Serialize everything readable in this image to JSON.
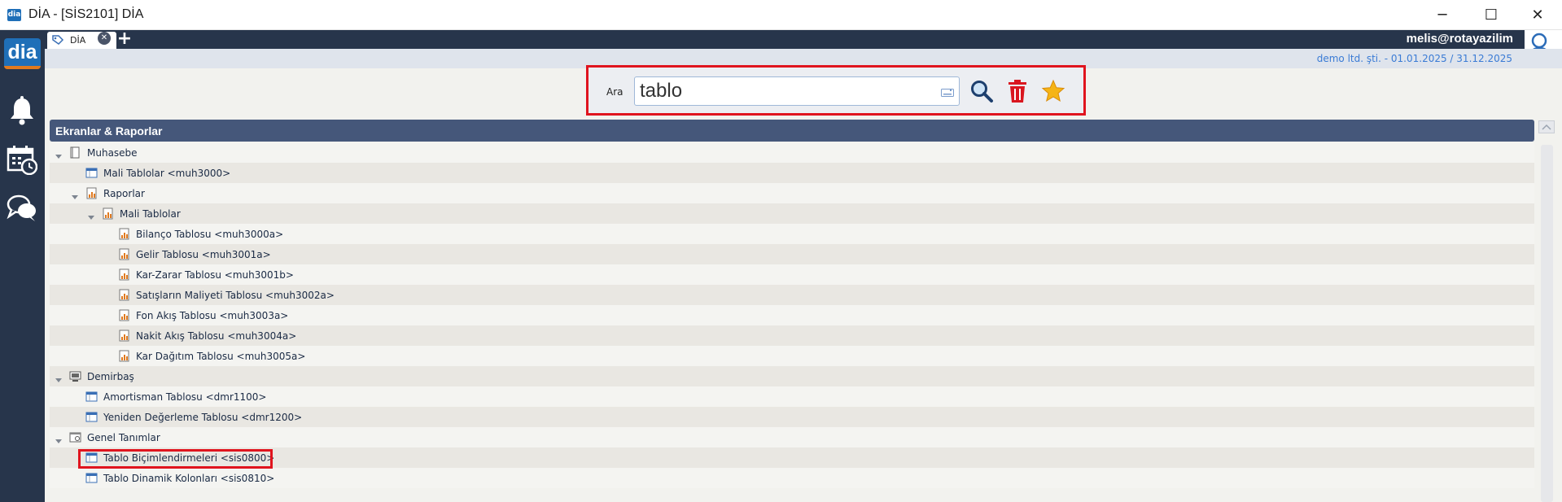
{
  "window": {
    "title": "DİA - [SİS2101] DİA",
    "minimize": "─",
    "maximize": "☐",
    "close": "✕"
  },
  "sidebar": {
    "logo": "dia",
    "icons": [
      "bell-icon",
      "calendar-clock-icon",
      "chat-icon"
    ]
  },
  "tabs": [
    {
      "label": "DİA",
      "close": "✕"
    }
  ],
  "tab_add": "+",
  "user": {
    "email": "melis@rotayazilim",
    "period": "demo ltd. şti. - 01.01.2025 / 31.12.2025"
  },
  "search": {
    "label": "Ara",
    "value": "tablo",
    "buttons": [
      "search-icon",
      "trash-icon",
      "star-icon"
    ]
  },
  "panel": {
    "title": "Ekranlar & Raporlar"
  },
  "tree": [
    {
      "label": "Muhasebe",
      "level": 0,
      "expanded": true,
      "icon": "book-icon"
    },
    {
      "label": "Mali Tablolar <muh3000>",
      "level": 1,
      "icon": "window-icon"
    },
    {
      "label": "Raporlar",
      "level": 1,
      "expanded": true,
      "icon": "report-icon"
    },
    {
      "label": "Mali Tablolar",
      "level": 2,
      "expanded": true,
      "icon": "report-icon"
    },
    {
      "label": "Bilanço Tablosu <muh3000a>",
      "level": 3,
      "icon": "report-icon"
    },
    {
      "label": "Gelir Tablosu <muh3001a>",
      "level": 3,
      "icon": "report-icon"
    },
    {
      "label": "Kar-Zarar Tablosu <muh3001b>",
      "level": 3,
      "icon": "report-icon"
    },
    {
      "label": "Satışların Maliyeti Tablosu <muh3002a>",
      "level": 3,
      "icon": "report-icon"
    },
    {
      "label": "Fon Akış Tablosu <muh3003a>",
      "level": 3,
      "icon": "report-icon"
    },
    {
      "label": "Nakit Akış Tablosu <muh3004a>",
      "level": 3,
      "icon": "report-icon"
    },
    {
      "label": "Kar Dağıtım Tablosu <muh3005a>",
      "level": 3,
      "icon": "report-icon"
    },
    {
      "label": "Demirbaş",
      "level": 0,
      "expanded": true,
      "icon": "monitor-icon"
    },
    {
      "label": "Amortisman Tablosu <dmr1100>",
      "level": 1,
      "icon": "window-icon"
    },
    {
      "label": "Yeniden Değerleme Tablosu <dmr1200>",
      "level": 1,
      "icon": "window-icon"
    },
    {
      "label": "Genel Tanımlar",
      "level": 0,
      "expanded": true,
      "icon": "settings-window-icon"
    },
    {
      "label": "Tablo Biçimlendirmeleri <sis0800>",
      "level": 1,
      "icon": "window-icon",
      "highlighted": true
    },
    {
      "label": "Tablo Dinamik Kolonları <sis0810>",
      "level": 1,
      "icon": "window-icon"
    }
  ]
}
